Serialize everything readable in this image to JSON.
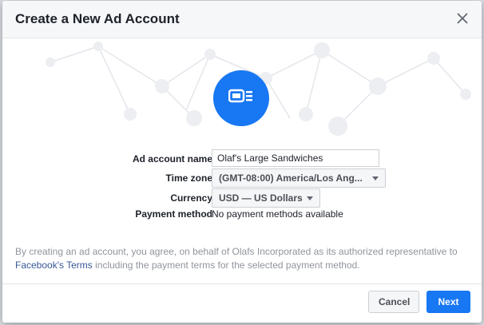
{
  "dialog": {
    "title": "Create a New Ad Account",
    "close_icon": "close-icon",
    "hero_icon": "ad-account-icon"
  },
  "form": {
    "ad_account_name": {
      "label": "Ad account name",
      "value": "Olaf's Large Sandwiches"
    },
    "time_zone": {
      "label": "Time zone",
      "value": "(GMT-08:00) America/Los Ang..."
    },
    "currency": {
      "label": "Currency",
      "value": "USD — US Dollars"
    },
    "payment_method": {
      "label": "Payment method",
      "value": "No payment methods available"
    }
  },
  "terms": {
    "before": "By creating an ad account, you agree, on behalf of Olafs Incorporated as its authorized representative to ",
    "link": "Facebook's Terms",
    "after": " including the payment terms for the selected payment method."
  },
  "footer": {
    "cancel_label": "Cancel",
    "next_label": "Next"
  },
  "colors": {
    "accent": "#1877f2",
    "link": "#385898"
  }
}
